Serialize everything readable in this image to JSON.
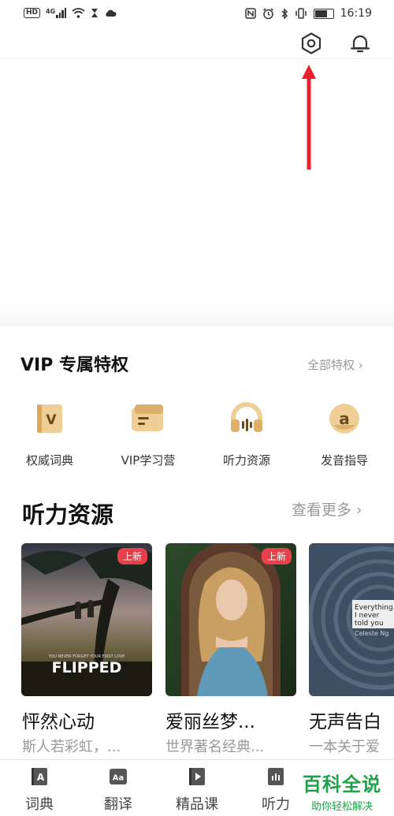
{
  "status_bar": {
    "network_badge": "HD",
    "network_type": "4G",
    "time": "16:19",
    "icons": [
      "signal-icon",
      "wifi-icon",
      "hourglass-icon",
      "cloud-icon",
      "nfc-icon",
      "alarm-icon",
      "bluetooth-icon",
      "vibrate-icon",
      "battery-icon"
    ]
  },
  "header": {
    "icons": [
      "settings-icon",
      "bell-icon"
    ]
  },
  "annotation": {
    "arrow_color": "#e8202a"
  },
  "vip": {
    "title": "VIP 专属特权",
    "all_label": "全部特权 ›",
    "items": [
      {
        "label": "权威词典",
        "icon": "dictionary-v-icon"
      },
      {
        "label": "VIP学习营",
        "icon": "card-icon"
      },
      {
        "label": "听力资源",
        "icon": "headphones-icon"
      },
      {
        "label": "发音指导",
        "icon": "pronunciation-icon"
      }
    ],
    "accent": "#e9c487"
  },
  "listening": {
    "title": "听力资源",
    "more_label": "查看更多 ›",
    "cards": [
      {
        "title": "怦然心动",
        "subtitle": "斯人若彩虹，...",
        "badge": "上新",
        "poster_text": "FLIPPED",
        "poster_tagline": "YOU NEVER FORGET YOUR FIRST LOVE"
      },
      {
        "title": "爱丽丝梦...",
        "subtitle": "世界著名经典...",
        "badge": "上新"
      },
      {
        "title": "无声告白",
        "subtitle": "一本关于爱",
        "cover_text": [
          "Everything",
          "I never",
          "told you"
        ],
        "cover_author": "Celeste Ng"
      }
    ]
  },
  "bottom_nav": [
    {
      "label": "词典",
      "icon": "dictionary-icon"
    },
    {
      "label": "翻译",
      "icon": "translate-icon"
    },
    {
      "label": "精品课",
      "icon": "video-course-icon"
    },
    {
      "label": "听力",
      "icon": "listening-icon"
    }
  ],
  "watermark": {
    "title": "百科全说",
    "subtitle": "助你轻松解决",
    "color": "#1fa24a"
  }
}
